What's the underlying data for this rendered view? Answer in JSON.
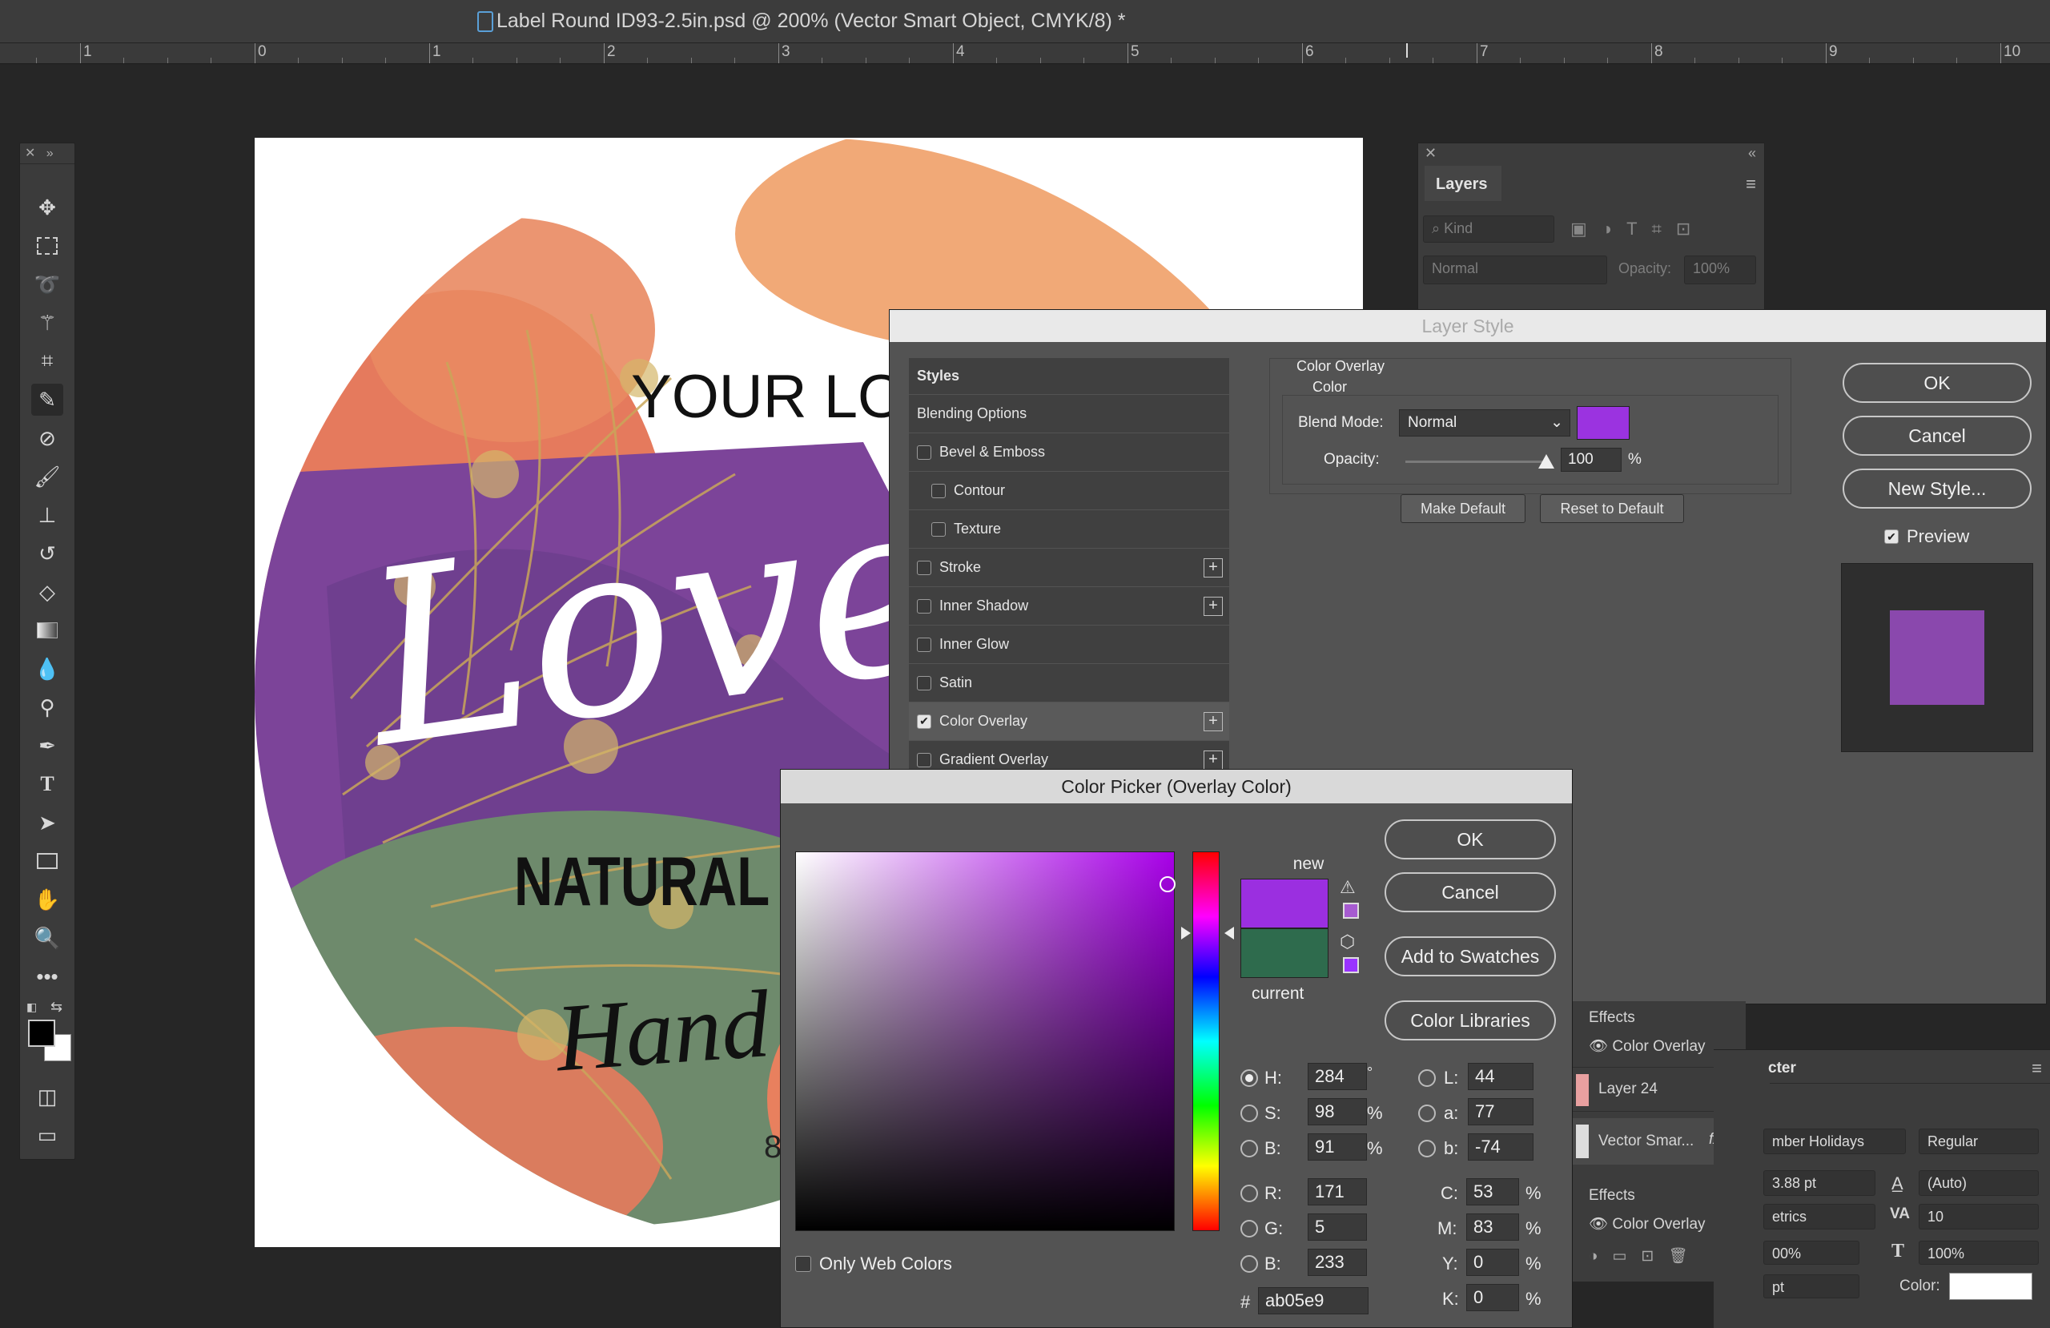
{
  "window": {
    "title": "Label Round ID93-2.5in.psd @ 200% (Vector Smart Object, CMYK/8) *"
  },
  "ruler": {
    "labels": [
      "1",
      "0",
      "1",
      "2",
      "3",
      "4",
      "5",
      "6",
      "7",
      "8",
      "9",
      "10"
    ]
  },
  "artwork": {
    "line1": "YOUR LO",
    "script_word": "Love",
    "line2": "NATURAL E",
    "script_line": "Hand mad",
    "number_fragment": "8"
  },
  "layers_panel": {
    "tab": "Layers",
    "kind_label": "Kind",
    "blend": "Normal",
    "opacity_label": "Opacity:",
    "opacity_value": "100%"
  },
  "layer_style": {
    "title": "Layer Style",
    "styles_header": "Styles",
    "items": [
      {
        "label": "Blending Options",
        "checkbox": false,
        "checked": false,
        "plus": false
      },
      {
        "label": "Bevel & Emboss",
        "checkbox": true,
        "checked": false,
        "plus": false
      },
      {
        "label": "Contour",
        "checkbox": true,
        "checked": false,
        "plus": false,
        "indent": true
      },
      {
        "label": "Texture",
        "checkbox": true,
        "checked": false,
        "plus": false,
        "indent": true
      },
      {
        "label": "Stroke",
        "checkbox": true,
        "checked": false,
        "plus": true
      },
      {
        "label": "Inner Shadow",
        "checkbox": true,
        "checked": false,
        "plus": true
      },
      {
        "label": "Inner Glow",
        "checkbox": true,
        "checked": false,
        "plus": false
      },
      {
        "label": "Satin",
        "checkbox": true,
        "checked": false,
        "plus": false
      },
      {
        "label": "Color Overlay",
        "checkbox": true,
        "checked": true,
        "plus": true
      },
      {
        "label": "Gradient Overlay",
        "checkbox": true,
        "checked": false,
        "plus": true
      }
    ],
    "section_title": "Color Overlay",
    "section_sub": "Color",
    "blend_mode_label": "Blend Mode:",
    "blend_mode_value": "Normal",
    "overlay_color": "#9b33e0",
    "opacity_label": "Opacity:",
    "opacity_value": "100",
    "opacity_unit": "%",
    "make_default": "Make Default",
    "reset_default": "Reset to Default",
    "ok": "OK",
    "cancel": "Cancel",
    "new_style": "New Style...",
    "preview_label": "Preview",
    "preview_checked": true,
    "preview_swatch": "#8a48ad"
  },
  "color_picker": {
    "title": "Color Picker (Overlay Color)",
    "new_label": "new",
    "current_label": "current",
    "new_color": "#9b2fe0",
    "current_color": "#2e6b4d",
    "ok": "OK",
    "cancel": "Cancel",
    "add_swatches": "Add to Swatches",
    "color_libraries": "Color Libraries",
    "only_web": "Only Web Colors",
    "hsb": {
      "H": "284",
      "S": "98",
      "B": "91"
    },
    "hsb_units": {
      "H": "°",
      "S": "%",
      "B": "%"
    },
    "rgb": {
      "R": "171",
      "G": "5",
      "B": "233"
    },
    "lab": {
      "L": "44",
      "a": "77",
      "b": "-74"
    },
    "cmyk": {
      "C": "53",
      "M": "83",
      "Y": "0",
      "K": "0"
    },
    "hex_label": "#",
    "hex": "ab05e9"
  },
  "layers_list": {
    "effects1": "Effects",
    "overlay1": "Color Overlay",
    "layer24": "Layer 24",
    "vector": "Vector Smar...",
    "fx": "fx",
    "effects2": "Effects",
    "overlay2": "Color Overlay"
  },
  "character": {
    "tab": "cter",
    "font_name": "mber Holidays",
    "font_style": "Regular",
    "size": "3.88 pt",
    "leading": "(Auto)",
    "kerning": "etrics",
    "tracking": "10",
    "vscale": "00%",
    "hscale": "100%",
    "baseline": "pt",
    "color_label": "Color:"
  }
}
